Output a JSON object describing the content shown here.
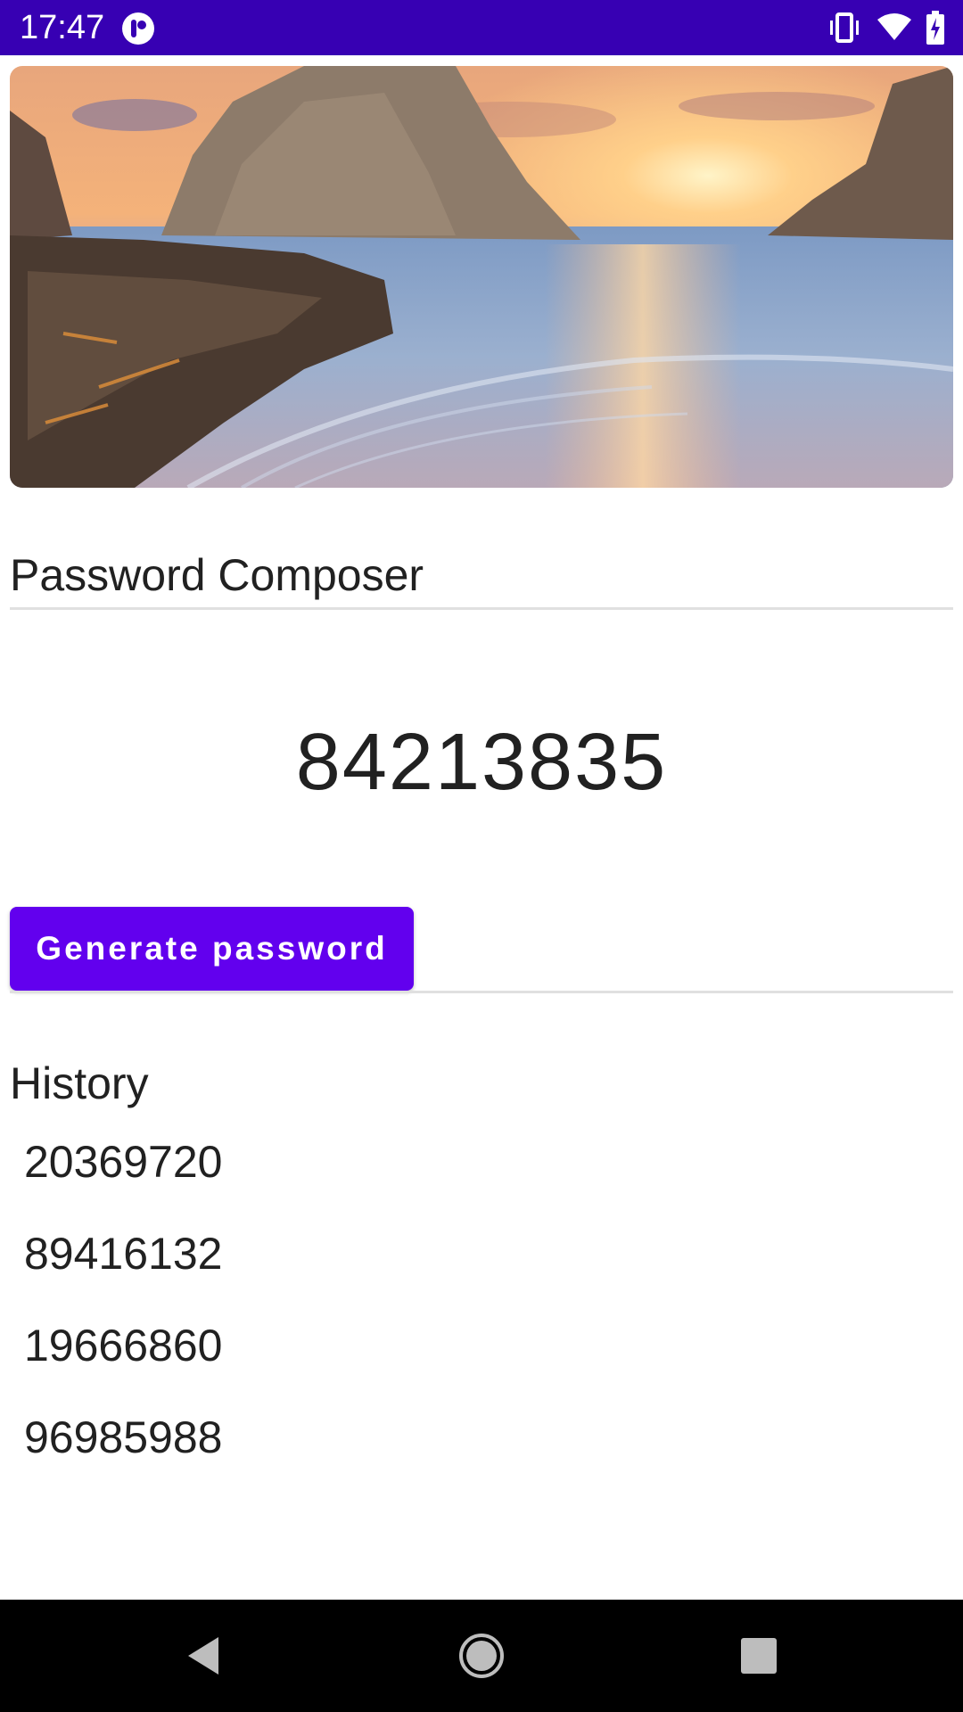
{
  "status_bar": {
    "time": "17:47",
    "background": "#3700B3",
    "icons": [
      "app-notification-icon",
      "vibrate-icon",
      "wifi-icon",
      "battery-charging-icon"
    ]
  },
  "hero_image": {
    "description_icon": "beach-sunset-image"
  },
  "composer": {
    "title": "Password Composer",
    "password": "84213835",
    "generate_label": "Generate password",
    "accent": "#6200EE"
  },
  "history": {
    "title": "History",
    "items": [
      "20369720",
      "89416132",
      "19666860",
      "96985988"
    ]
  },
  "nav_bar": {
    "buttons": [
      "back-icon",
      "home-icon",
      "recents-icon"
    ]
  }
}
